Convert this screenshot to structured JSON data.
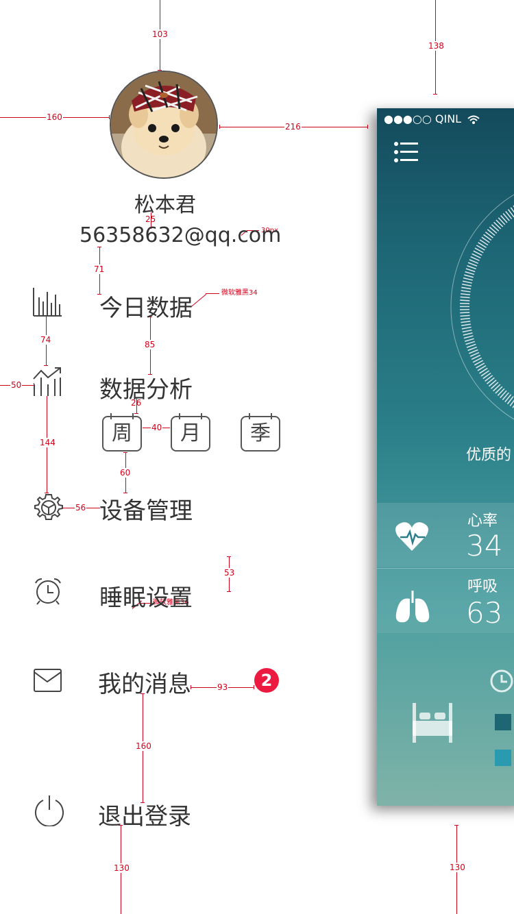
{
  "profile": {
    "name": "松本君",
    "email": "56358632@qq.com"
  },
  "menu": {
    "today_data": "今日数据",
    "analysis": "数据分析",
    "periods": [
      "周",
      "月",
      "季"
    ],
    "device": "设备管理",
    "sleep": "睡眠设置",
    "messages": "我的消息",
    "messages_badge": "2",
    "logout": "退出登录"
  },
  "annotations": {
    "top_left": "103",
    "top_right": "138",
    "left_avatar": "160",
    "avatar_right": "216",
    "name_email": "25",
    "email_size": "30px",
    "email_menu": "71",
    "font_note_34": "微软雅黑34",
    "icon_gap_1": "74",
    "menu_gap_1": "85",
    "icon_left": "50",
    "label_period": "26",
    "period_gap": "40",
    "icon_gap_2": "144",
    "period_device": "60",
    "icon_label": "56",
    "row_height": "53",
    "font_note_36": "微软雅黑36",
    "badge_gap": "93",
    "msg_logout": "160",
    "bottom_left": "130",
    "bottom_right": "130"
  },
  "phone": {
    "status": "●●●○○ QINL",
    "quality_text": "优质的",
    "heart_label": "心率",
    "heart_value": "34",
    "breath_label": "呼吸",
    "breath_value": "63"
  },
  "colors": {
    "accent_red": "#d0021b",
    "badge": "#ec1a40",
    "legend_dark": "#1e6673",
    "legend_light": "#2a9ab0"
  }
}
